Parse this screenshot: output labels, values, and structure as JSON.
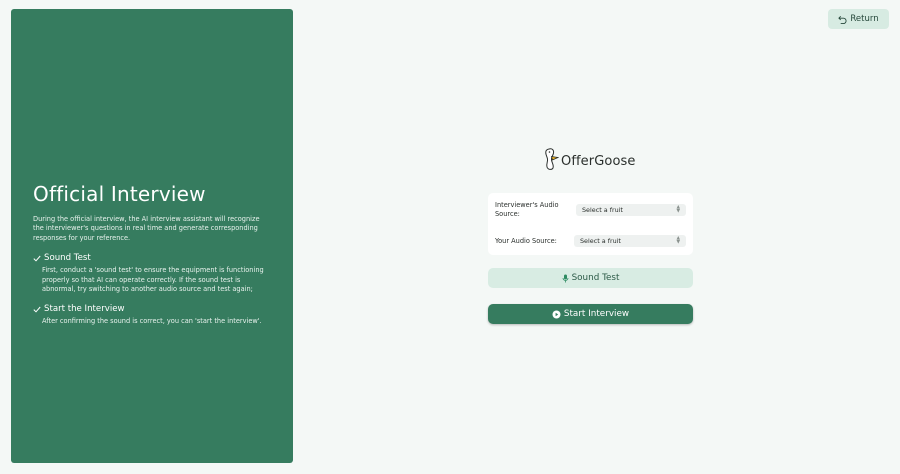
{
  "left_panel": {
    "title": "Official Interview",
    "description": "During the official interview, the AI interview assistant will recognize the interviewer's questions in real time and generate corresponding responses for your reference.",
    "steps": [
      {
        "title": "Sound Test",
        "text": "First, conduct a 'sound test' to ensure the equipment is functioning properly so that AI can operate correctly. If the sound test is abnormal, try switching to another audio source and test again;"
      },
      {
        "title": "Start the Interview",
        "text": "After confirming the sound is correct, you can 'start the interview'."
      }
    ]
  },
  "header": {
    "return_label": "Return"
  },
  "logo": {
    "text": "OfferGoose"
  },
  "form": {
    "interviewer_label": "Interviewer's Audio Source:",
    "interviewer_value": "Select a fruit",
    "own_label": "Your Audio Source:",
    "own_value": "Select a fruit"
  },
  "actions": {
    "sound_test_label": "Sound Test",
    "start_label": "Start Interview"
  },
  "colors": {
    "brand": "#367c5f",
    "light_accent": "#d8ece3",
    "background": "#f4f8f6"
  }
}
